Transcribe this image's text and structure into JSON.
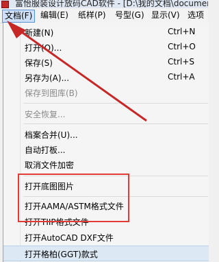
{
  "window": {
    "title": "富怡服装设计放码CAD软件 - [D:\\我的文档\\documents"
  },
  "menubar": {
    "items": [
      {
        "label": "文档(F)",
        "active": true
      },
      {
        "label": "编辑(E)"
      },
      {
        "label": "纸样(P)"
      },
      {
        "label": "号型(G)"
      },
      {
        "label": "显示(V)"
      },
      {
        "label": "选项"
      }
    ]
  },
  "file_menu": {
    "items": [
      {
        "label": "新建(N)",
        "shortcut": "Ctrl+N"
      },
      {
        "label": "打开(O)...",
        "shortcut": "Ctrl+O"
      },
      {
        "label": "保存(S)",
        "shortcut": "Ctrl+S"
      },
      {
        "label": "另存为(A)...",
        "shortcut": "Ctrl+A"
      },
      {
        "label": "保存到图库(B)",
        "disabled": true
      },
      {
        "label": "安全恢复...",
        "disabled": true
      },
      {
        "label": "档案合并(U)..."
      },
      {
        "label": "自动打板..."
      },
      {
        "label": "取消文件加密"
      },
      {
        "label": "打开底图图片"
      },
      {
        "label": "打开AAMA/ASTM格式文件"
      },
      {
        "label": "打开TIIP格式文件"
      },
      {
        "label": "打开AutoCAD DXF文件"
      },
      {
        "label": "打开格柏(GGT)款式"
      }
    ]
  },
  "annotation": {
    "arrow_color": "#c62828",
    "highlight_color": "#e53935"
  }
}
